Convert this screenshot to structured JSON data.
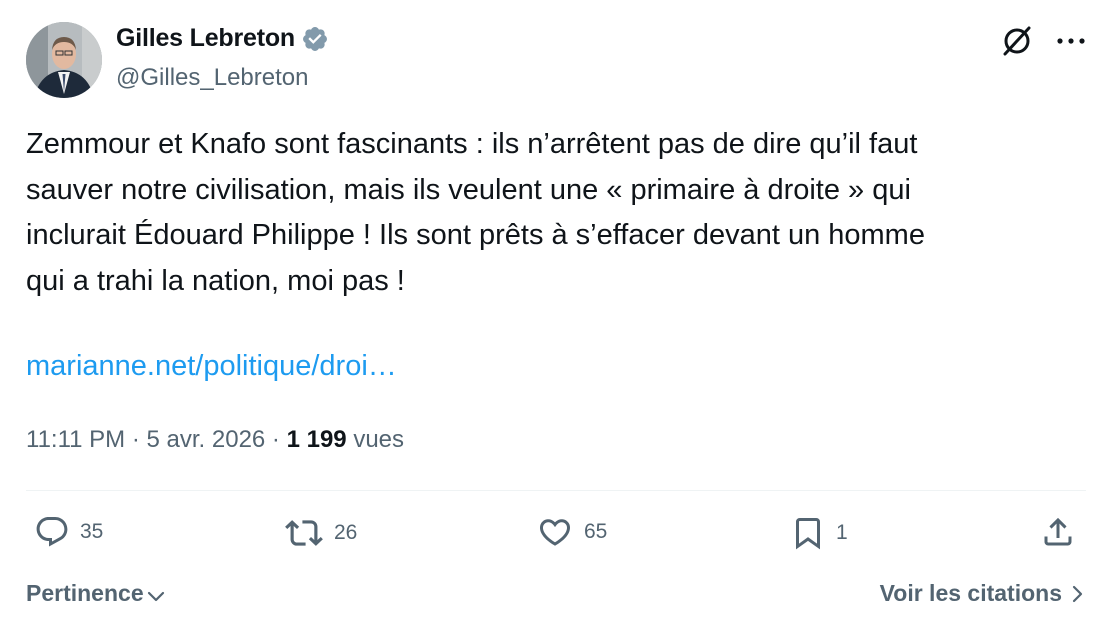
{
  "author": {
    "name": "Gilles Lebreton",
    "handle": "@Gilles_Lebreton",
    "verified_icon": "verified-badge-icon"
  },
  "header_icons": [
    "grok-icon",
    "more-icon"
  ],
  "tweet": {
    "text": "Zemmour et Knafo sont fascinants : ils n’arrêtent pas de dire qu’il faut\nsauver notre civilisation, mais ils veulent une « primaire à droite » qui\ninclurait Édouard Philippe ! Ils sont prêts à s’effacer devant un homme\nqui a trahi la nation, moi pas !",
    "link": "marianne.net/politique/droi…"
  },
  "meta": {
    "time": "11:11 PM",
    "separator": " · ",
    "date": "5 avr. 2026",
    "views_count": "1 199",
    "views_label": " vues"
  },
  "actions": {
    "replies": "35",
    "reposts": "26",
    "likes": "65",
    "bookmarks": "1"
  },
  "footer": {
    "sort_label": "Pertinence",
    "quotes_label": "Voir les citations"
  },
  "colors": {
    "text": "#0f1419",
    "secondary": "#536471",
    "link": "#1d9bf0",
    "verified": "#829aab"
  }
}
